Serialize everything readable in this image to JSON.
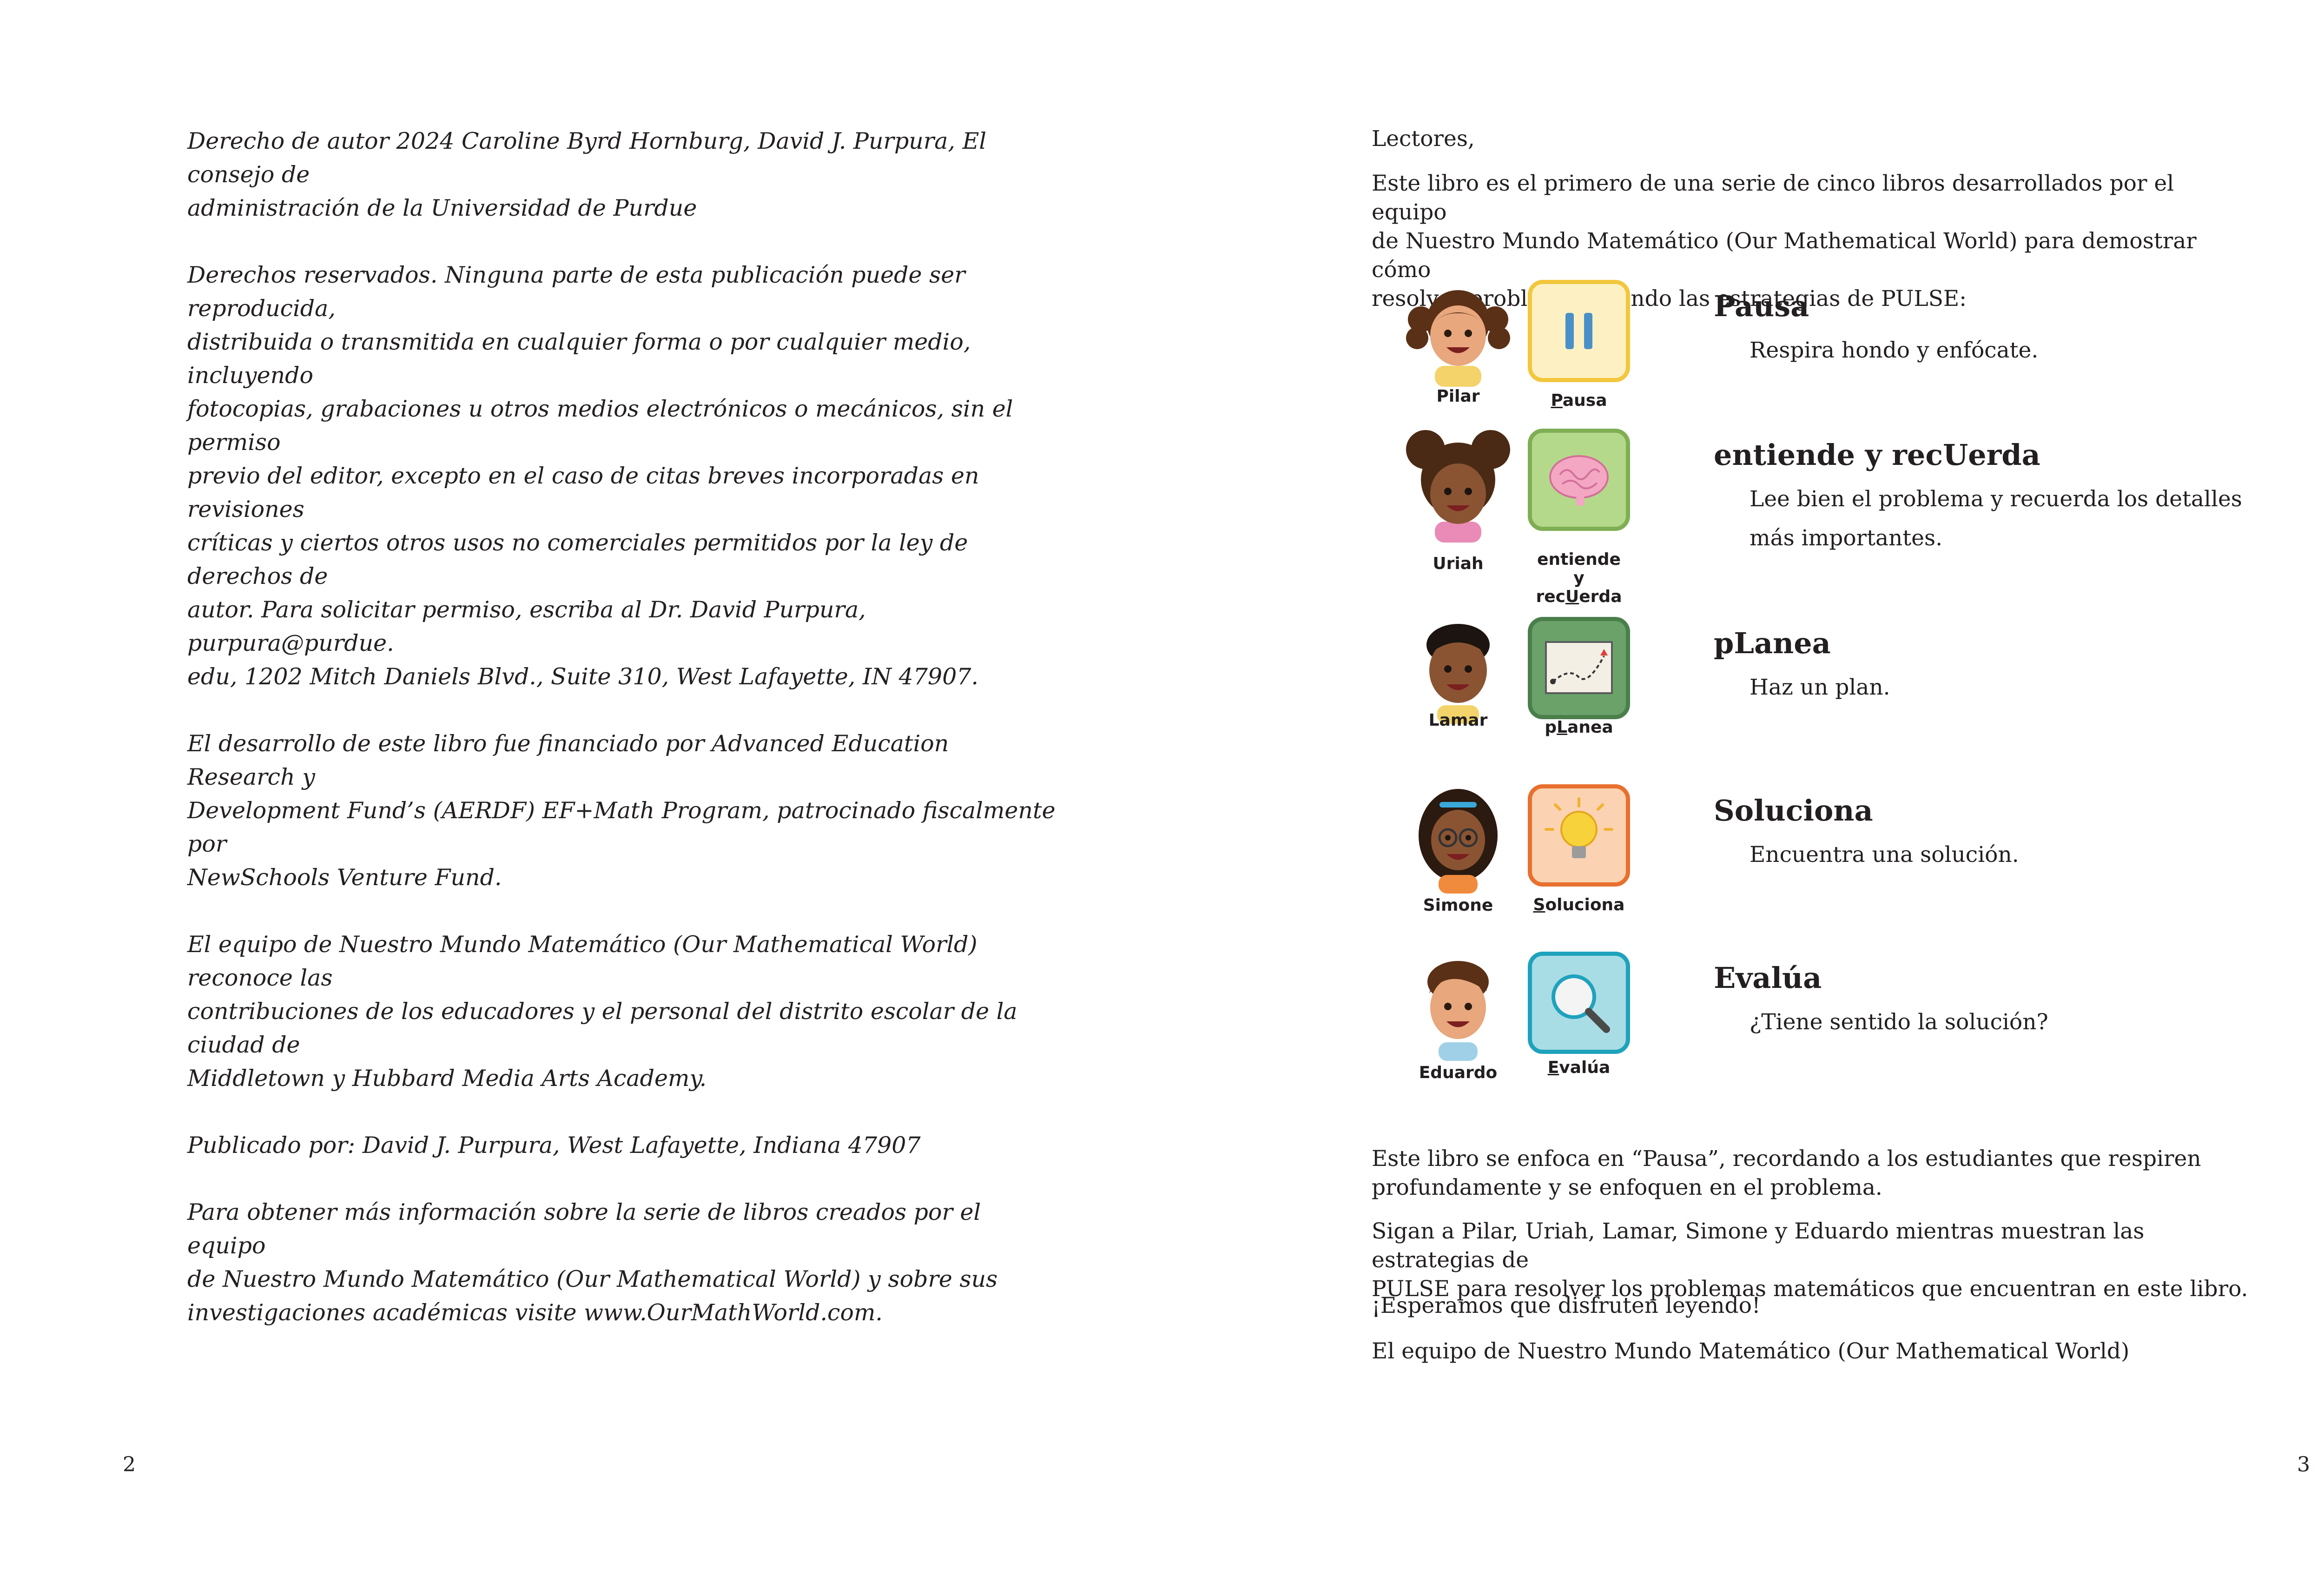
{
  "left_page": {
    "paragraphs": [
      "Derecho de autor 2024 Caroline Byrd Hornburg, David J. Purpura, El consejo de\nadministración de la Universidad de Purdue",
      "Derechos reservados. Ninguna parte de esta publicación puede ser reproducida,\ndistribuida o transmitida en cualquier forma o por cualquier medio, incluyendo\nfotocopias, grabaciones u otros medios electrónicos o mecánicos, sin el permiso\nprevio del editor, excepto en el caso de citas breves incorporadas en revisiones\ncríticas y ciertos otros usos no comerciales permitidos por la ley de derechos de\nautor. Para solicitar permiso, escriba al Dr. David Purpura, purpura@purdue.\nedu, 1202 Mitch Daniels Blvd., Suite 310, West Lafayette, IN 47907.",
      "El desarrollo de este libro fue financiado por Advanced Education Research y\nDevelopment Fund’s (AERDF) EF+Math Program, patrocinado fiscalmente por\nNewSchools Venture Fund.",
      "El equipo de Nuestro Mundo Matemático (Our Mathematical World) reconoce las\ncontribuciones de los educadores y el personal del distrito escolar de la ciudad de\nMiddletown y Hubbard Media Arts Academy.",
      "Publicado por: David J. Purpura, West Lafayette, Indiana 47907",
      "Para obtener más información sobre la serie de libros creados por el equipo\nde Nuestro Mundo Matemático (Our Mathematical World) y sobre sus\ninvestigaciones académicas visite www.OurMathWorld.com."
    ],
    "page_number": "2"
  },
  "right_page": {
    "greeting": "Lectores,",
    "intro": "Este libro es el primero de una serie de cinco libros desarrollados por el equipo\nde Nuestro Mundo Matemático (Our Mathematical World) para demostrar cómo\nresolver problemas usando las estrategias de PULSE:",
    "steps": [
      {
        "kid": "Pilar",
        "tile_pre": "",
        "tile_ul": "P",
        "tile_post": "ausa",
        "title": "Pausa",
        "desc": "Respira hondo y enfócate.",
        "tile_bg": "#fdf1c3",
        "tile_border": "#f3c73d",
        "icon": "pause-icon"
      },
      {
        "kid": "Uriah",
        "tile_pre": "entiende\ny\nrec",
        "tile_ul": "U",
        "tile_post": "erda",
        "title": "entiende y recUerda",
        "desc": "Lee bien el problema y recuerda los detalles más importantes.",
        "tile_bg": "#b5d98b",
        "tile_border": "#7fae54",
        "icon": "brain-icon"
      },
      {
        "kid": "Lamar",
        "tile_pre": "p",
        "tile_ul": "L",
        "tile_post": "anea",
        "title": "pLanea",
        "desc": "Haz un plan.",
        "tile_bg": "#6aa26a",
        "tile_border": "#4a7f4c",
        "icon": "map-route-icon"
      },
      {
        "kid": "Simone",
        "tile_pre": "",
        "tile_ul": "S",
        "tile_post": "oluciona",
        "title": "Soluciona",
        "desc": "Encuentra una solución.",
        "tile_bg": "#fbd3b2",
        "tile_border": "#e8702e",
        "icon": "lightbulb-icon"
      },
      {
        "kid": "Eduardo",
        "tile_pre": "",
        "tile_ul": "E",
        "tile_post": "valúa",
        "title": "Evalúa",
        "desc": "¿Tiene sentido la solución?",
        "tile_bg": "#a9dde5",
        "tile_border": "#1fa2bd",
        "icon": "magnifier-icon"
      }
    ],
    "outro": [
      "Este libro se enfoca en “Pausa”, recordando a los estudiantes que respiren\nprofundamente y se enfoquen en el problema.",
      "Sigan a Pilar, Uriah, Lamar, Simone y Eduardo mientras muestran las estrategias de\nPULSE para resolver los problemas matemáticos que encuentran en este libro.",
      "¡Esperamos que disfruten leyendo!",
      "El equipo de Nuestro Mundo Matemático (Our Mathematical World)"
    ],
    "page_number": "3"
  },
  "colors": {
    "text": "#231f20",
    "skin_light": "#e8a77c",
    "skin_dark": "#8a5433",
    "hair_brown": "#5a3017",
    "hair_black": "#1c1410"
  }
}
